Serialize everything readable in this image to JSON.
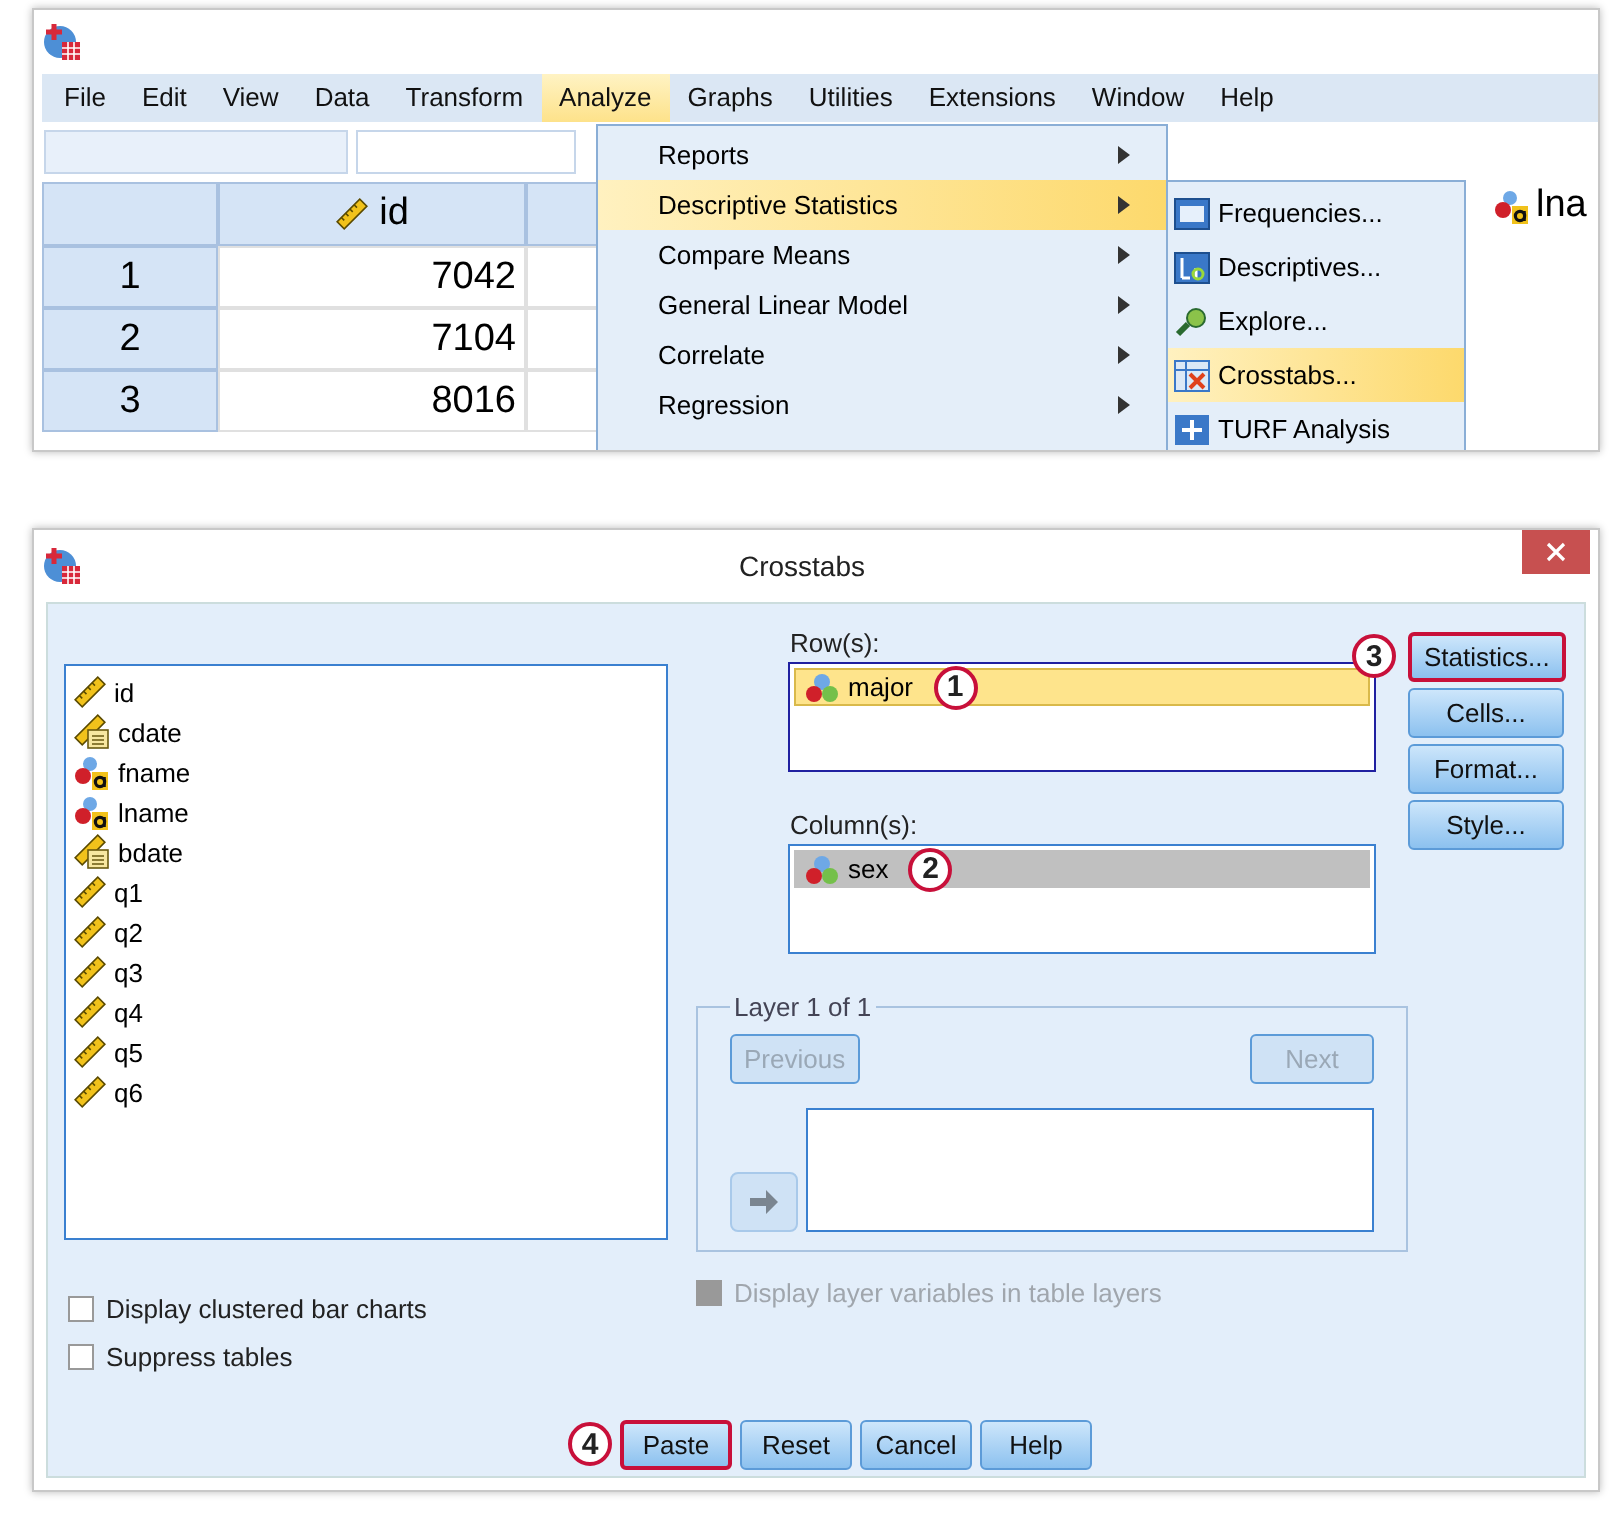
{
  "data_editor": {
    "menu_bar": [
      {
        "label": "File",
        "selected": false
      },
      {
        "label": "Edit",
        "selected": false
      },
      {
        "label": "View",
        "selected": false
      },
      {
        "label": "Data",
        "selected": false
      },
      {
        "label": "Transform",
        "selected": false
      },
      {
        "label": "Analyze",
        "selected": true
      },
      {
        "label": "Graphs",
        "selected": false
      },
      {
        "label": "Utilities",
        "selected": false
      },
      {
        "label": "Extensions",
        "selected": false
      },
      {
        "label": "Window",
        "selected": false
      },
      {
        "label": "Help",
        "selected": false
      }
    ],
    "grid": {
      "columns": [
        {
          "label": "id",
          "kind": "scale"
        }
      ],
      "partial_column": {
        "label": "lna",
        "kind": "string"
      },
      "rows": [
        {
          "number": "1",
          "id": "7042"
        },
        {
          "number": "2",
          "id": "7104"
        },
        {
          "number": "3",
          "id": "8016"
        }
      ]
    },
    "analyze_menu": [
      {
        "label": "Reports",
        "selected": false
      },
      {
        "label": "Descriptive Statistics",
        "selected": true
      },
      {
        "label": "Compare Means",
        "selected": false
      },
      {
        "label": "General Linear Model",
        "selected": false
      },
      {
        "label": "Correlate",
        "selected": false
      },
      {
        "label": "Regression",
        "selected": false
      }
    ],
    "submenu": [
      {
        "label": "Frequencies...",
        "kind": "frequencies",
        "selected": false
      },
      {
        "label": "Descriptives...",
        "kind": "descriptives",
        "selected": false
      },
      {
        "label": "Explore...",
        "kind": "explore",
        "selected": false
      },
      {
        "label": "Crosstabs...",
        "kind": "crosstabs",
        "selected": true
      },
      {
        "label": "TURF Analysis",
        "kind": "turf",
        "selected": false
      }
    ]
  },
  "dialog": {
    "title": "Crosstabs",
    "variables": [
      {
        "name": "id",
        "kind": "scale"
      },
      {
        "name": "cdate",
        "kind": "date"
      },
      {
        "name": "fname",
        "kind": "string"
      },
      {
        "name": "lname",
        "kind": "string"
      },
      {
        "name": "bdate",
        "kind": "date"
      },
      {
        "name": "q1",
        "kind": "scale"
      },
      {
        "name": "q2",
        "kind": "scale"
      },
      {
        "name": "q3",
        "kind": "scale"
      },
      {
        "name": "q4",
        "kind": "scale"
      },
      {
        "name": "q5",
        "kind": "scale"
      },
      {
        "name": "q6",
        "kind": "scale"
      }
    ],
    "rows_label": "Row(s):",
    "row_vars": [
      {
        "name": "major",
        "kind": "nominal",
        "selected": true,
        "focused": true,
        "callout": "1"
      }
    ],
    "columns_label": "Column(s):",
    "column_vars": [
      {
        "name": "sex",
        "kind": "nominal",
        "selected": true,
        "focused": false,
        "callout": "2"
      }
    ],
    "layer": {
      "title": "Layer 1 of 1",
      "previous": {
        "label": "Previous",
        "disabled": true
      },
      "next": {
        "label": "Next",
        "disabled": true
      }
    },
    "layer_option": {
      "label": "Display layer variables in table layers",
      "checked": false,
      "disabled": true
    },
    "options": [
      {
        "label": "Display clustered bar charts",
        "checked": false
      },
      {
        "label": "Suppress tables",
        "checked": false
      }
    ],
    "side_buttons": [
      {
        "label": "Statistics...",
        "callout": "3"
      },
      {
        "label": "Cells..."
      },
      {
        "label": "Format..."
      },
      {
        "label": "Style..."
      }
    ],
    "bottom_buttons": [
      {
        "label": "Paste",
        "callout": "4"
      },
      {
        "label": "Reset"
      },
      {
        "label": "Cancel"
      },
      {
        "label": "Help"
      }
    ]
  }
}
